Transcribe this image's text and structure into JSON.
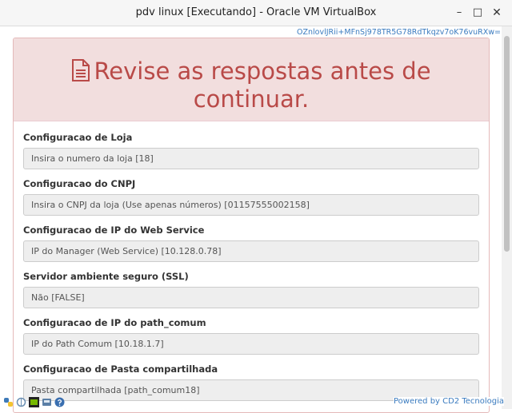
{
  "window": {
    "title": "pdv linux [Executando] - Oracle VM VirtualBox",
    "minimize_label": "–",
    "maximize_label": "□",
    "close_label": "✕"
  },
  "token": "OZnlovlJRii+MFnSj978TR5G78RdTkqzv7oK76vuRXw=",
  "panel": {
    "heading": "Revise as respostas antes de continuar."
  },
  "fields": [
    {
      "label": "Configuracao de Loja",
      "value": "Insira o numero da loja [18]"
    },
    {
      "label": "Configuracao do CNPJ",
      "value": "Insira o CNPJ da loja (Use apenas números) [01157555002158]"
    },
    {
      "label": "Configuracao de IP do Web Service",
      "value": "IP do Manager (Web Service) [10.128.0.78]"
    },
    {
      "label": "Servidor ambiente seguro (SSL)",
      "value": "Não [FALSE]"
    },
    {
      "label": "Configuracao de IP do path_comum",
      "value": "IP do Path Comum [10.18.1.7]"
    },
    {
      "label": "Configuracao de Pasta compartilhada",
      "value": "Pasta compartilhada [path_comum18]"
    }
  ],
  "footer": {
    "powered_by": "Powered by CD2 Tecnologia"
  },
  "colors": {
    "danger_text": "#b94a48",
    "danger_bg": "#f2dede",
    "link": "#3a7bbf"
  }
}
